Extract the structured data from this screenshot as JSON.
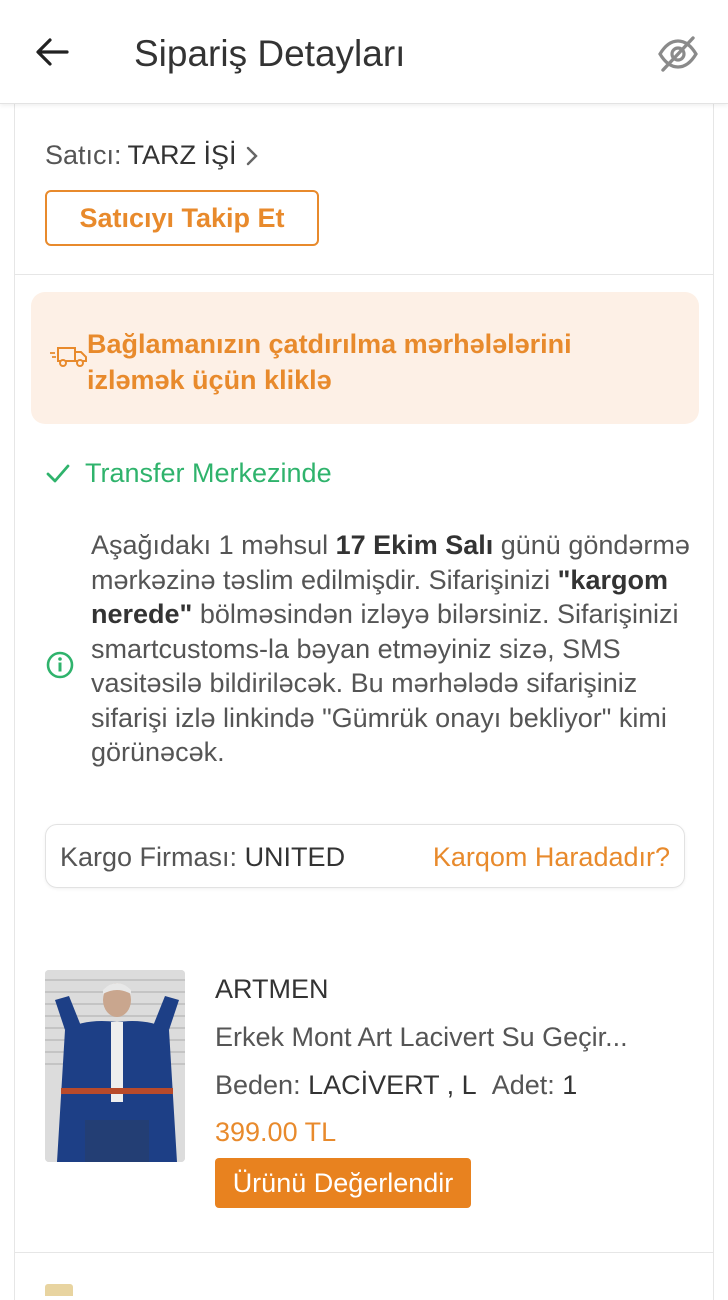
{
  "header": {
    "title": "Sipariş Detayları",
    "back_icon": "arrow-left-icon",
    "visibility_icon": "eye-off-icon"
  },
  "seller": {
    "label": "Satıcı:",
    "name": "TARZ İŞİ",
    "chevron": "›",
    "follow_label": "Satıcıyı Takip Et"
  },
  "tracking": {
    "icon": "truck-icon",
    "text": "Bağlamanızın çatdırılma mərhələlərini izləmək üçün kliklə"
  },
  "status": {
    "icon": "check-icon",
    "text": "Transfer Merkezinde"
  },
  "info": {
    "icon": "info-icon",
    "p1": "Aşağıdakı 1 məhsul ",
    "date": "17 Ekim Salı",
    "p2": " günü göndərmə mərkəzinə təslim edilmişdir. Sifarişinizi ",
    "section": "\"kargom nerede\"",
    "p3": " bölməsindən izləyə bilərsiniz. Sifarişinizi smartcustoms-la bəyan etməyiniz sizə, SMS vasitəsilə bildiriləcək. Bu mərhələdə sifarişiniz sifarişi izlə linkində \"Gümrük onayı bekliyor\" kimi görünəcək."
  },
  "cargo": {
    "label": "Kargo Firması:",
    "company": "UNITED",
    "where_link": "Karqom Haradadır?"
  },
  "product": {
    "brand": "ARTMEN",
    "name": "Erkek Mont Art Lacivert Su Geçir...",
    "size_label": "Beden:",
    "size_value": "LACİVERT , L",
    "qty_label": "Adet:",
    "qty_value": "1",
    "price": "399.00 TL",
    "rate_label": "Ürünü Değerlendir"
  },
  "colors": {
    "accent": "#e88a2c",
    "success": "#2fb36c",
    "track_bg": "#fdf0e6"
  }
}
